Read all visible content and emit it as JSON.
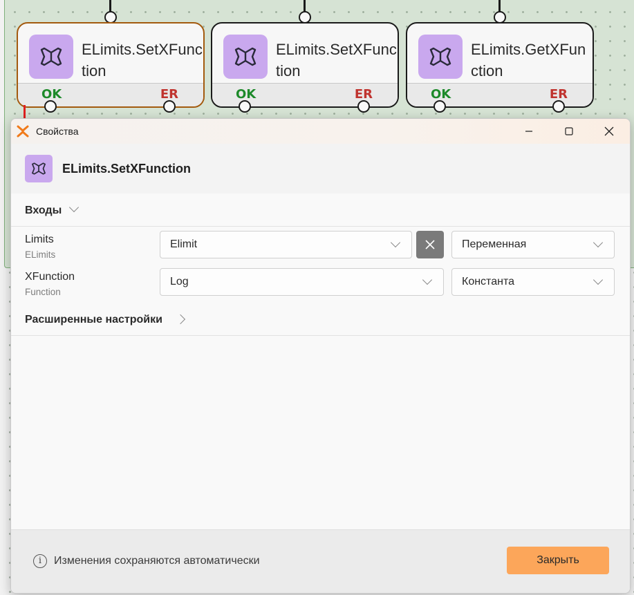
{
  "graph": {
    "nodes": [
      {
        "title": "ELimits.SetXFunction",
        "ok": "OK",
        "er": "ER",
        "selected": true
      },
      {
        "title": "ELimits.SetXFunction",
        "ok": "OK",
        "er": "ER",
        "selected": false
      },
      {
        "title": "ELimits.GetXFunction",
        "ok": "OK",
        "er": "ER",
        "selected": false
      }
    ]
  },
  "dialog": {
    "window_title": "Свойства",
    "header_title": "ELimits.SetXFunction",
    "inputs_section": "Входы",
    "params": [
      {
        "name": "Limits",
        "type": "ELimits",
        "value": "Elimit",
        "mode": "Переменная"
      },
      {
        "name": "XFunction",
        "type": "Function",
        "value": "Log",
        "mode": "Константа"
      }
    ],
    "advanced_section": "Расширенные настройки",
    "footer_info": "Изменения сохраняются автоматически",
    "close_label": "Закрыть"
  },
  "colors": {
    "accent": "#fca65a",
    "icon_bg": "#c9a8ee",
    "ok": "#1d8a2a",
    "er": "#c0332e",
    "selected_border": "#a35a0e",
    "link_arrow": "#e02020"
  },
  "icons": {
    "node": "butterfly-icon",
    "app": "app-logo-icon",
    "info": "info-icon"
  }
}
